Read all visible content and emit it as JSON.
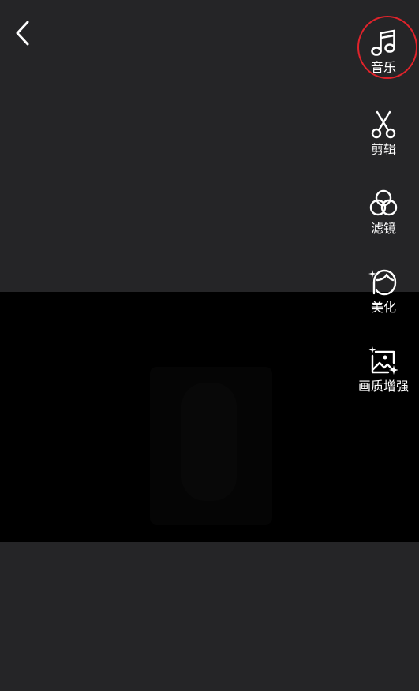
{
  "header": {
    "back_icon": "chevron-left-icon"
  },
  "toolbar": {
    "items": [
      {
        "id": "music",
        "label": "音乐",
        "icon": "music-note-icon"
      },
      {
        "id": "edit",
        "label": "剪辑",
        "icon": "scissors-icon"
      },
      {
        "id": "filter",
        "label": "滤镜",
        "icon": "filter-circles-icon"
      },
      {
        "id": "beauty",
        "label": "美化",
        "icon": "face-sparkle-icon"
      },
      {
        "id": "enhance",
        "label": "画质增强",
        "icon": "image-sparkle-icon"
      }
    ],
    "highlight_color": "#e0232b"
  },
  "colors": {
    "background": "#252527",
    "video_background": "#000000",
    "text": "#ffffff"
  }
}
